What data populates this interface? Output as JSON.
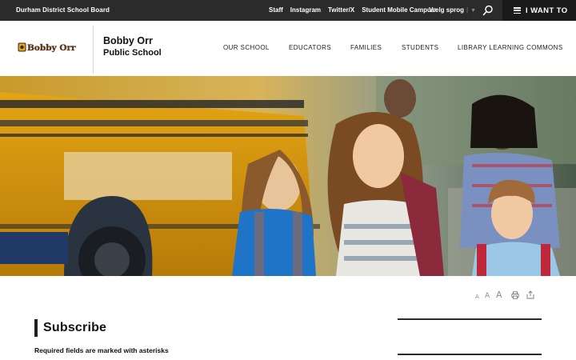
{
  "topbar": {
    "board_name": "Durham District School Board",
    "links": [
      "Staff",
      "Instagram",
      "Twitter/X",
      "Student Mobile Campus"
    ],
    "language": "Vælg sprog",
    "i_want_to": "I WANT TO"
  },
  "header": {
    "logo_text": "Bobby Orr PS",
    "school_line1": "Bobby Orr",
    "school_line2": "Public School",
    "nav": [
      "OUR SCHOOL",
      "EDUCATORS",
      "FAMILIES",
      "STUDENTS",
      "LIBRARY LEARNING COMMONS"
    ]
  },
  "toolbar": {
    "text_sizes": [
      "A",
      "A",
      "A"
    ]
  },
  "content": {
    "heading": "Subscribe",
    "required_note": "Required fields are marked with asterisks"
  },
  "colors": {
    "topbar_bg": "#2b2b2b",
    "i_want_bg": "#1a1a1a"
  }
}
